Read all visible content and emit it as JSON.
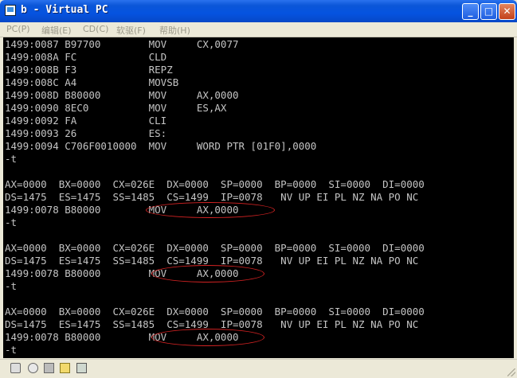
{
  "window": {
    "title": "b - Virtual PC",
    "buttons": {
      "minimize": "_",
      "maximize": "□",
      "close": "✕"
    }
  },
  "menu": [
    "PC(P)",
    "编辑(E)",
    "CD(C)",
    "软驱(F)",
    "帮助(H)"
  ],
  "terminal": {
    "lines": [
      "1499:0087 B97700        MOV     CX,0077",
      "1499:008A FC            CLD",
      "1499:008B F3            REPZ",
      "1499:008C A4            MOVSB",
      "1499:008D B80000        MOV     AX,0000",
      "1499:0090 8EC0          MOV     ES,AX",
      "1499:0092 FA            CLI",
      "1499:0093 26            ES:",
      "1499:0094 C706F0010000  MOV     WORD PTR [01F0],0000",
      "-t",
      "",
      "AX=0000  BX=0000  CX=026E  DX=0000  SP=0000  BP=0000  SI=0000  DI=0000",
      "DS=1475  ES=1475  SS=1485  CS=1499  IP=0078   NV UP EI PL NZ NA PO NC",
      "1499:0078 B80000        MOV     AX,0000",
      "-t",
      "",
      "AX=0000  BX=0000  CX=026E  DX=0000  SP=0000  BP=0000  SI=0000  DI=0000",
      "DS=1475  ES=1475  SS=1485  CS=1499  IP=0078   NV UP EI PL NZ NA PO NC",
      "1499:0078 B80000        MOV     AX,0000",
      "-t",
      "",
      "AX=0000  BX=0000  CX=026E  DX=0000  SP=0000  BP=0000  SI=0000  DI=0000",
      "DS=1475  ES=1475  SS=1485  CS=1499  IP=0078   NV UP EI PL NZ NA PO NC",
      "1499:0078 B80000        MOV     AX,0000",
      "-t"
    ]
  },
  "status_icons": [
    "hard-disk-icon",
    "cd-drive-icon",
    "floppy-icon",
    "shared-folder-icon",
    "network-icon"
  ],
  "colors": {
    "terminal_bg": "#000000",
    "terminal_fg": "#c4c4c4",
    "annotation": "#d22222",
    "titlebar": "#0553e0"
  }
}
